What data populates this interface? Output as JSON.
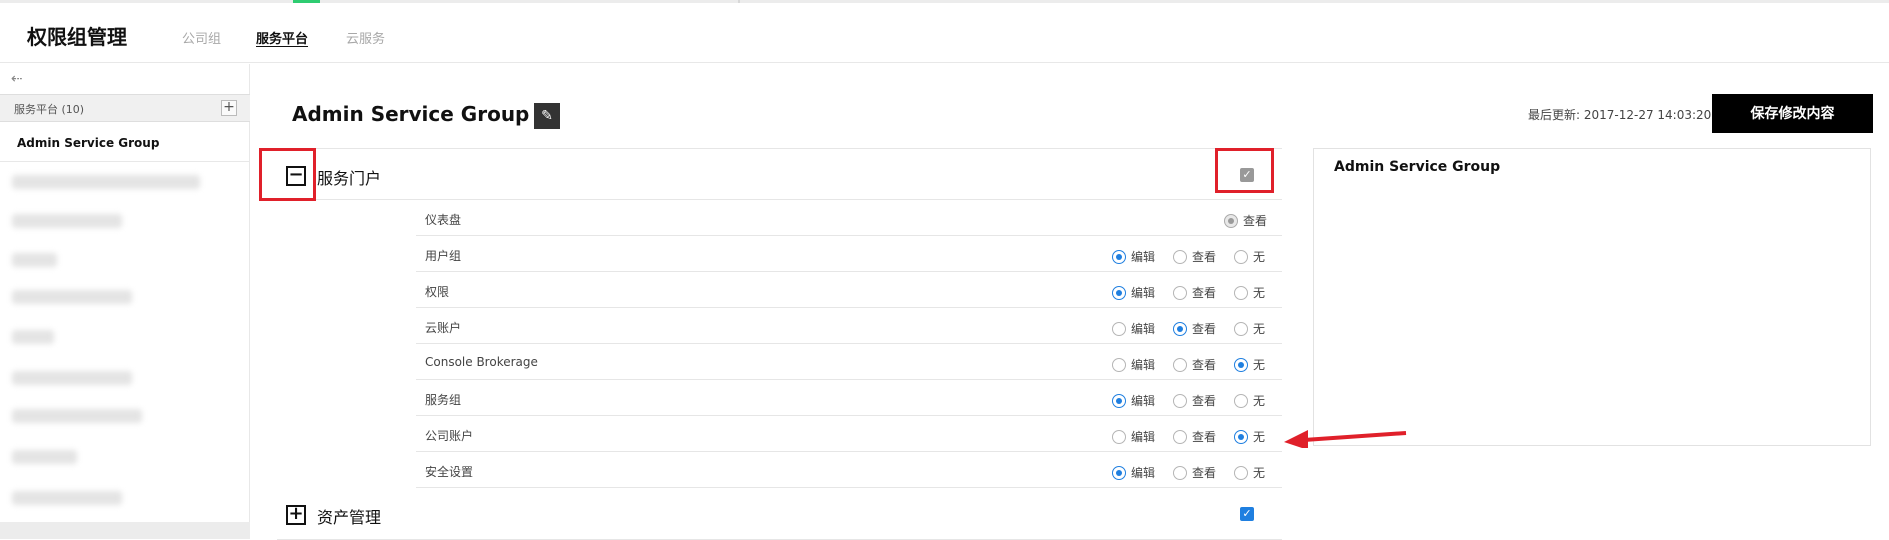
{
  "header": {
    "title": "权限组管理",
    "tabs": [
      {
        "label": "公司组",
        "active": false
      },
      {
        "label": "服务平台",
        "active": true
      },
      {
        "label": "云服务",
        "active": false
      }
    ]
  },
  "sidebar": {
    "collapse_icon": "collapse-left-icon",
    "group_label": "服务平台 (10)",
    "add_icon": "+",
    "active_item": "Admin Service Group"
  },
  "main": {
    "title": "Admin Service Group",
    "edit_icon": "✎",
    "last_update": "最后更新: 2017-12-27 14:03:20",
    "save_label": "保存修改内容"
  },
  "option_labels": {
    "edit": "编辑",
    "view": "查看",
    "none": "无"
  },
  "sections": [
    {
      "name": "服务门户",
      "expanded": true,
      "toggle": "−",
      "check": "✓",
      "rows": [
        {
          "name": "仪表盘",
          "selected": "view",
          "view_only": true
        },
        {
          "name": "用户组",
          "selected": "edit"
        },
        {
          "name": "权限",
          "selected": "edit"
        },
        {
          "name": "云账户",
          "selected": "view"
        },
        {
          "name": "Console Brokerage",
          "selected": "none"
        },
        {
          "name": "服务组",
          "selected": "edit"
        },
        {
          "name": "公司账户",
          "selected": "none"
        },
        {
          "name": "安全设置",
          "selected": "edit"
        }
      ]
    },
    {
      "name": "资产管理",
      "expanded": false,
      "toggle": "+",
      "check": "✓"
    }
  ],
  "side_panel": {
    "title": "Admin Service Group"
  },
  "colors": {
    "accent": "#1f7fe0",
    "highlight": "#e0202a",
    "topbar_accent": "#2ecc71"
  }
}
